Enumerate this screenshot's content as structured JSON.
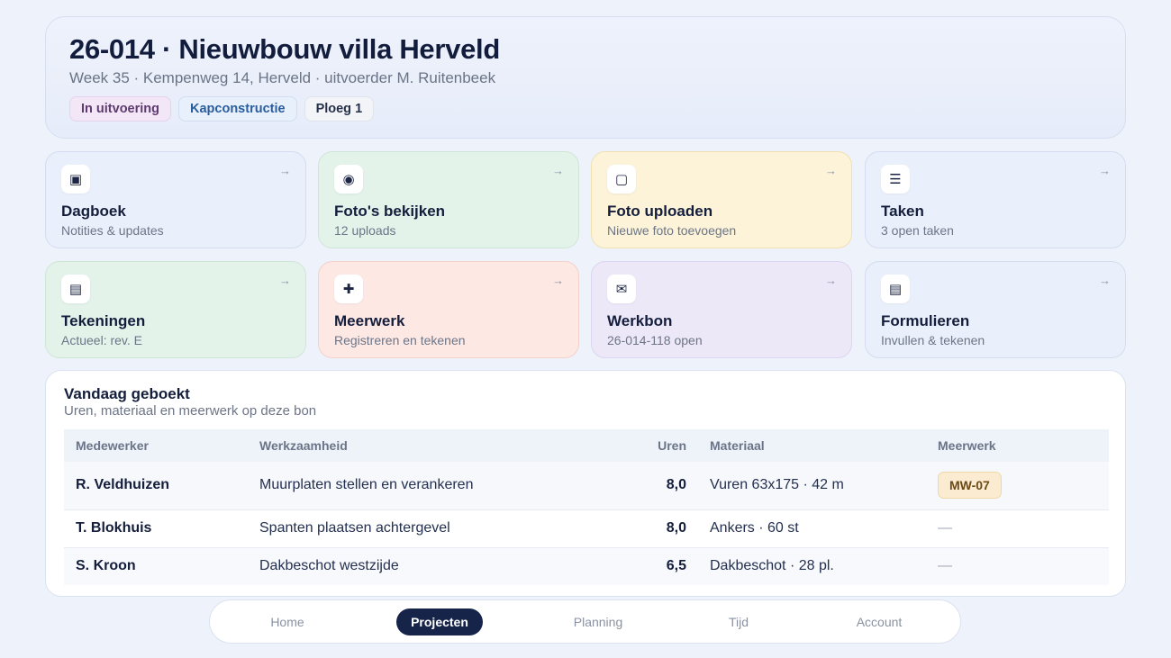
{
  "header": {
    "title": "26-014 · Nieuwbouw villa Herveld",
    "subtitle": "Week 35 · Kempenweg 14, Herveld · uitvoerder M. Ruitenbeek",
    "chips": {
      "status": "In uitvoering",
      "phase": "Kapconstructie",
      "crew": "Ploeg 1"
    }
  },
  "tiles": [
    {
      "icon": "▣",
      "icon_name": "logbook-icon",
      "title": "Dagboek",
      "subtitle": "Notities & updates",
      "color": "#eaf0fb"
    },
    {
      "icon": "◉",
      "icon_name": "photo-view-icon",
      "title": "Foto's bekijken",
      "subtitle": "12 uploads",
      "color": "#e3f3ea"
    },
    {
      "icon": "▢",
      "icon_name": "photo-upload-icon",
      "title": "Foto uploaden",
      "subtitle": "Nieuwe foto toevoegen",
      "color": "#fcf3d9"
    },
    {
      "icon": "☰",
      "icon_name": "tasks-icon",
      "title": "Taken",
      "subtitle": "3 open taken",
      "color": "#eaf0fb"
    },
    {
      "icon": "▤",
      "icon_name": "drawings-icon",
      "title": "Tekeningen",
      "subtitle": "Actueel: rev. E",
      "color": "#e3f3ea"
    },
    {
      "icon": "✚",
      "icon_name": "plus-icon",
      "title": "Meerwerk",
      "subtitle": "Registreren en tekenen",
      "color": "#fde8e4"
    },
    {
      "icon": "✉",
      "icon_name": "envelope-icon",
      "title": "Werkbon",
      "subtitle": "26-014-118 open",
      "color": "#ede8f8"
    },
    {
      "icon": "▤",
      "icon_name": "form-icon",
      "title": "Formulieren",
      "subtitle": "Invullen & tekenen",
      "color": "#eaf0fb"
    }
  ],
  "tile_arrow": "→",
  "booked": {
    "title": "Vandaag geboekt",
    "subtitle": "Uren, materiaal en meerwerk op deze bon",
    "columns": [
      "Medewerker",
      "Werkzaamheid",
      "Uren",
      "Materiaal",
      "Meerwerk"
    ],
    "rows": [
      {
        "employee": "R. Veldhuizen",
        "activity": "Muurplaten stellen en verankeren",
        "hours": "8,0",
        "material": "Vuren 63x175 · 42 m",
        "extra": "MW-07"
      },
      {
        "employee": "T. Blokhuis",
        "activity": "Spanten plaatsen achtergevel",
        "hours": "8,0",
        "material": "Ankers · 60 st",
        "extra": "—"
      },
      {
        "employee": "S. Kroon",
        "activity": "Dakbeschot westzijde",
        "hours": "6,5",
        "material": "Dakbeschot · 28 pl.",
        "extra": "—"
      }
    ]
  },
  "nav": {
    "items": [
      "Home",
      "Projecten",
      "Planning",
      "Tijd",
      "Account"
    ],
    "active": "Projecten"
  }
}
